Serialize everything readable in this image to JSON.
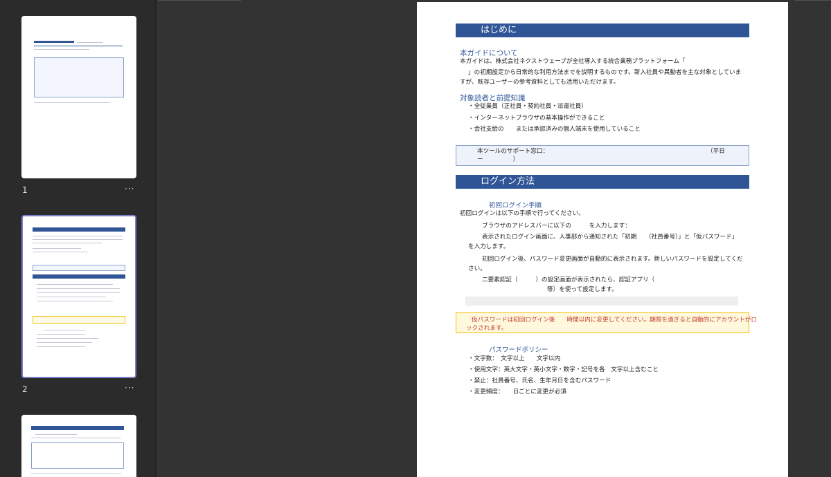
{
  "sidebar": {
    "thumbnails": [
      {
        "number": "1",
        "more": "···",
        "selected": false
      },
      {
        "number": "2",
        "more": "···",
        "selected": true
      },
      {
        "number": "",
        "more": "",
        "selected": false
      }
    ]
  },
  "page": {
    "section1": {
      "title": "はじめに",
      "about_heading": "本ガイドについて",
      "about_line1": "本ガイドは、株式会社ネクストウェーブが全社導入する統合業務プラットフォーム「",
      "about_line2": "」の初期設定から日常的な利用方法までを説明するものです。新入社員や異動者を主な対象としていま",
      "about_line3": "すが、既存ユーザーの参考資料としても活用いただけます。",
      "audience_heading": "対象読者と前提知識",
      "audience_items": [
        "・全従業員（正社員・契約社員・派遣社員）",
        "・インターネットブラウザの基本操作ができること",
        "・会社支給の　　または承認済みの個人端末を使用していること"
      ],
      "support_line1": "本ツールのサポート窓口：",
      "support_line1_right": "（平日",
      "support_line2": "ー　　　　　）"
    },
    "section2": {
      "title": "ログイン方法",
      "first_login_heading": "初回ログイン手順",
      "first_login_intro": "初回ログインは以下の手順で行ってください。",
      "steps": [
        "ブラウザのアドレスバーに以下の　　　を入力します：",
        "表示されたログイン画面に、人事部から通知された「初期　　（社員番号）」と「仮パスワード」",
        "を入力します。",
        "初回ログイン後、パスワード変更画面が自動的に表示されます。新しいパスワードを設定してくだ",
        "さい。",
        "二要素認証（　　　）の設定画面が表示されたら、認証アプリ（",
        "等）を使って設定します。"
      ],
      "warning_line1": "仮パスワードは初回ログイン後　　時間以内に変更してください。期限を過ぎると自動的にアカウントがロ",
      "warning_line2": "ックされます。",
      "policy_heading": "パスワードポリシー",
      "policy_items": [
        "・文字数：　文字以上　　文字以内",
        "・使用文字：英大文字・英小文字・数字・記号を各　文字以上含むこと",
        "・禁止：社員番号、氏名、生年月日を含むパスワード",
        "・変更頻度：　　日ごとに変更が必須"
      ]
    }
  }
}
